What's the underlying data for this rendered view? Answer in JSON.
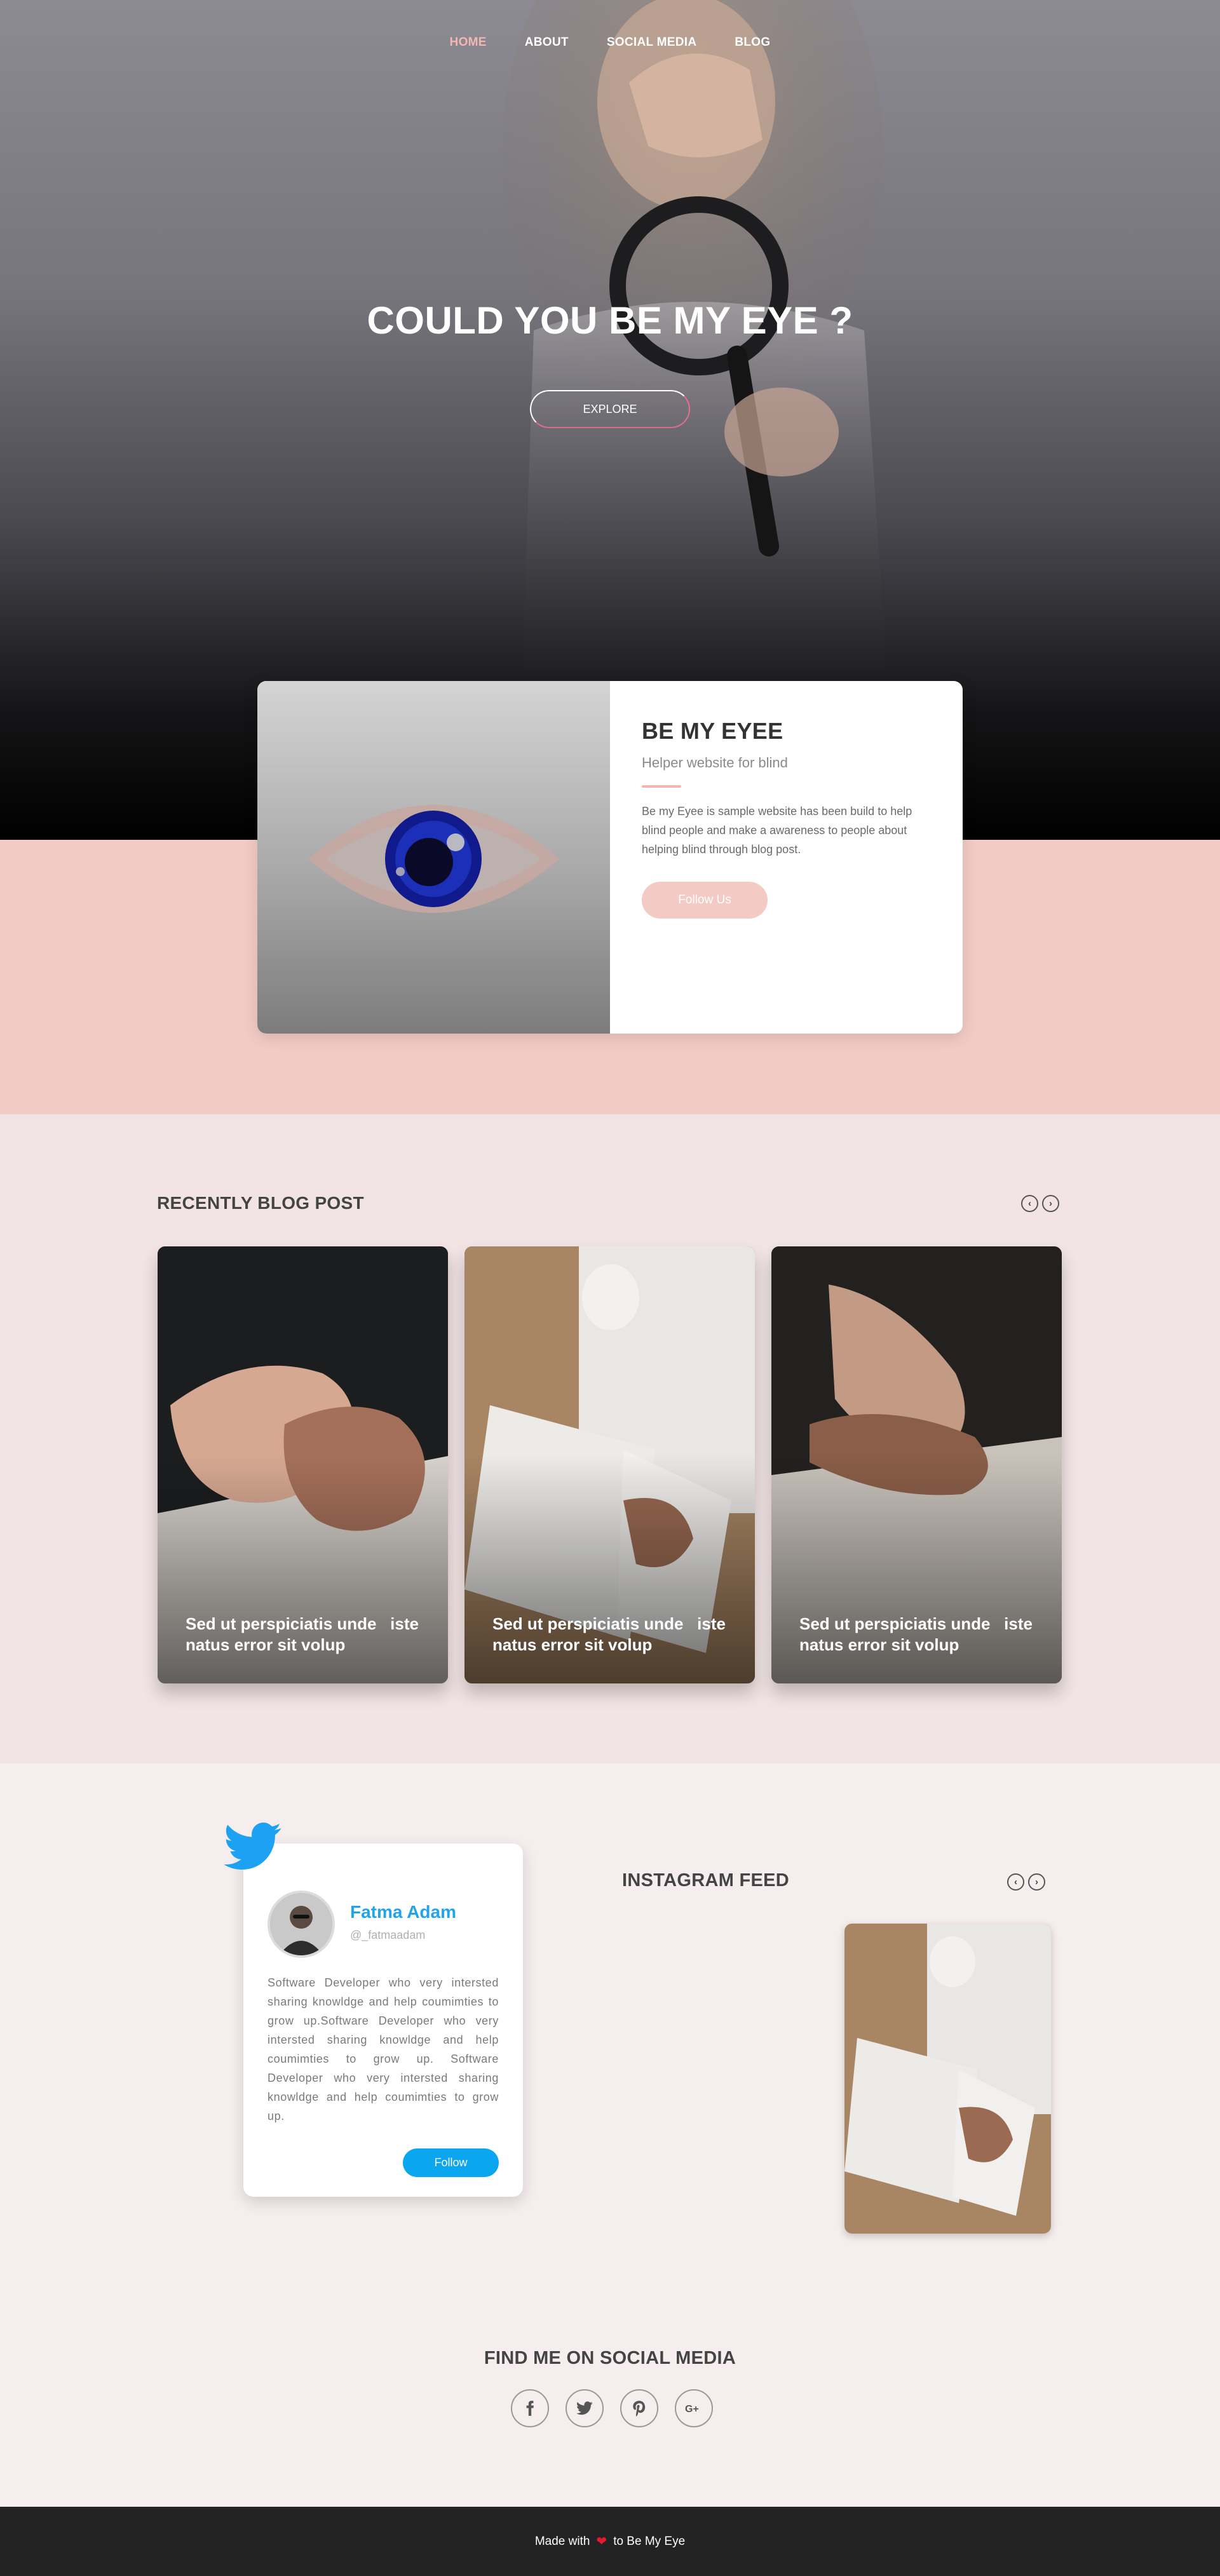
{
  "nav": {
    "items": [
      {
        "label": "HOME",
        "active": true
      },
      {
        "label": "ABOUT",
        "active": false
      },
      {
        "label": "SOCIAL MEDIA",
        "active": false
      },
      {
        "label": "BLOG",
        "active": false
      }
    ]
  },
  "hero": {
    "title": "COULD YOU BE MY EYE ?",
    "button_label": "EXPLORE"
  },
  "intro": {
    "title": "BE MY EYEE",
    "subtitle": "Helper website for blind",
    "description": "Be my Eyee is sample website has been build to help blind people and make a awareness to people about helping blind through blog post.",
    "button_label": "Follow Us"
  },
  "blog": {
    "title": "RECENTLY BLOG POST",
    "prev_glyph": "‹",
    "next_glyph": "›",
    "posts": [
      {
        "caption": "Sed ut perspiciatis unde   iste natus error sit volup"
      },
      {
        "caption": "Sed ut perspiciatis unde   iste natus error sit volup"
      },
      {
        "caption": "Sed ut perspiciatis unde   iste natus error sit volup"
      }
    ]
  },
  "twitter": {
    "name": "Fatma Adam",
    "handle": "@_fatmaadam",
    "bio": "Software Developer who very intersted sharing knowldge and help coumimties to grow up.Software Developer who very intersted sharing knowldge and help coumimties to grow up. Software Developer who very intersted sharing knowldge and help coumimties to grow up.",
    "button_label": "Follow"
  },
  "instagram": {
    "title": "INSTAGRAM FEED"
  },
  "social": {
    "title": "FIND ME ON SOCIAL MEDIA",
    "icons": [
      "facebook-icon",
      "twitter-icon",
      "pinterest-icon",
      "google-plus-icon"
    ]
  },
  "footer": {
    "made_with": "Made with",
    "to_text": "to Be My Eye"
  },
  "colors": {
    "accent_pink": "#f2b7b2",
    "twitter_blue": "#0aa6f0",
    "footer_bg": "#232323"
  }
}
